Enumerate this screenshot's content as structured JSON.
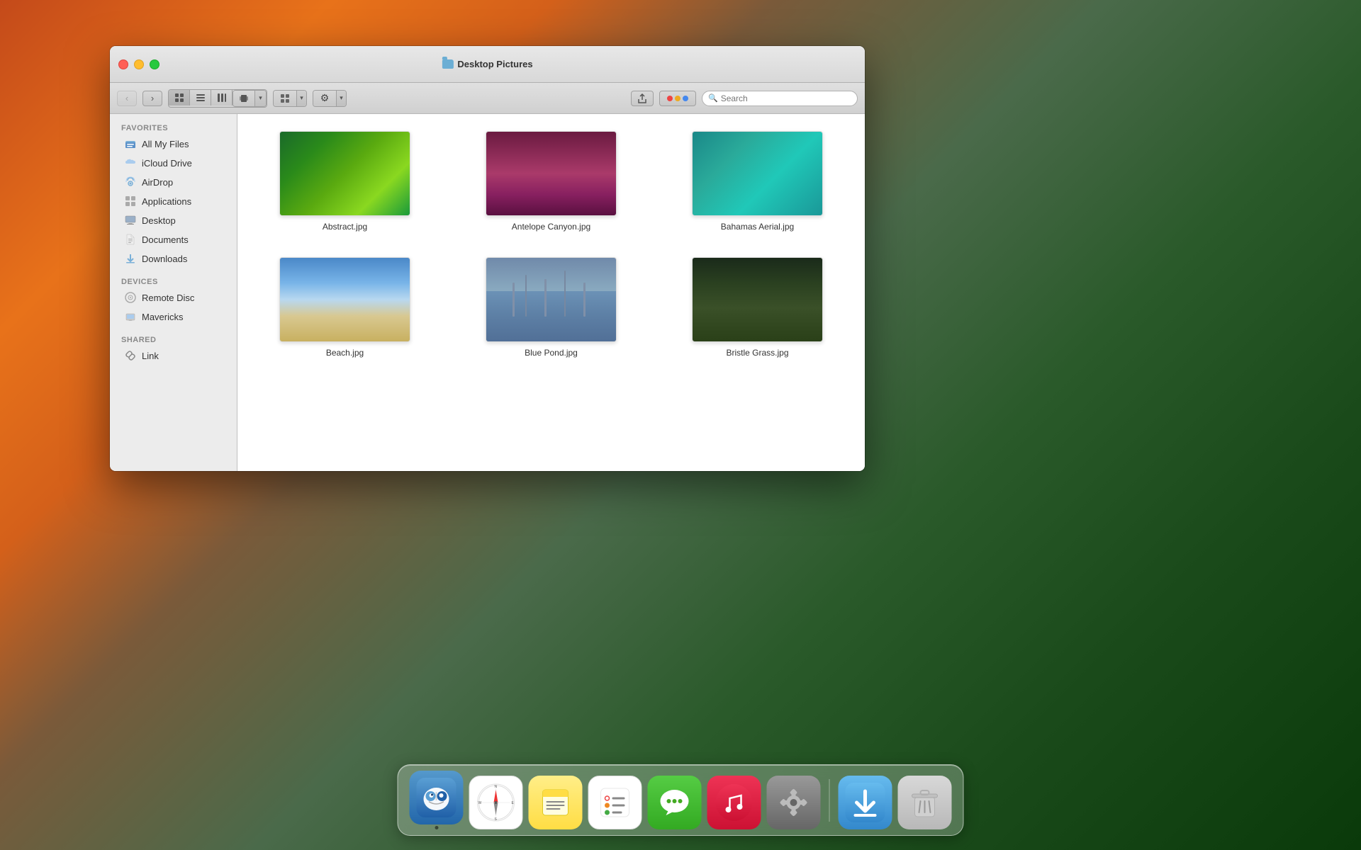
{
  "window": {
    "title": "Desktop Pictures",
    "buttons": {
      "close": "close",
      "minimize": "minimize",
      "maximize": "maximize"
    }
  },
  "toolbar": {
    "back_label": "‹",
    "forward_label": "›",
    "view_icon": "⊞",
    "list_icon": "≡",
    "column_icon": "⊟",
    "cover_icon": "⊞",
    "arrange_icon": "⊞",
    "gear_label": "⚙",
    "share_label": "↑",
    "tag_label": "●",
    "search_placeholder": "Search"
  },
  "sidebar": {
    "sections": [
      {
        "id": "favorites",
        "label": "Favorites",
        "items": [
          {
            "id": "all-my-files",
            "label": "All My Files",
            "icon": "star"
          },
          {
            "id": "icloud-drive",
            "label": "iCloud Drive",
            "icon": "cloud"
          },
          {
            "id": "airdrop",
            "label": "AirDrop",
            "icon": "airdrop"
          },
          {
            "id": "applications",
            "label": "Applications",
            "icon": "apps"
          },
          {
            "id": "desktop",
            "label": "Desktop",
            "icon": "desktop"
          },
          {
            "id": "documents",
            "label": "Documents",
            "icon": "doc"
          },
          {
            "id": "downloads",
            "label": "Downloads",
            "icon": "download"
          }
        ]
      },
      {
        "id": "devices",
        "label": "Devices",
        "items": [
          {
            "id": "remote-disc",
            "label": "Remote Disc",
            "icon": "disc"
          },
          {
            "id": "mavericks",
            "label": "Mavericks",
            "icon": "drive"
          }
        ]
      },
      {
        "id": "shared",
        "label": "Shared",
        "items": [
          {
            "id": "link",
            "label": "Link",
            "icon": "link"
          }
        ]
      }
    ]
  },
  "files": [
    {
      "id": "abstract",
      "name": "Abstract.jpg",
      "thumb": "abstract"
    },
    {
      "id": "antelope",
      "name": "Antelope Canyon.jpg",
      "thumb": "antelope"
    },
    {
      "id": "bahamas",
      "name": "Bahamas Aerial.jpg",
      "thumb": "bahamas"
    },
    {
      "id": "beach",
      "name": "Beach.jpg",
      "thumb": "beach"
    },
    {
      "id": "bluepond",
      "name": "Blue Pond.jpg",
      "thumb": "bluepond"
    },
    {
      "id": "bristle",
      "name": "Bristle Grass.jpg",
      "thumb": "bristle"
    }
  ],
  "dock": {
    "items": [
      {
        "id": "finder",
        "label": "Finder",
        "icon": "finder",
        "has_dot": true
      },
      {
        "id": "safari",
        "label": "Safari",
        "icon": "safari",
        "has_dot": false
      },
      {
        "id": "notes",
        "label": "Notes",
        "icon": "notes",
        "has_dot": false
      },
      {
        "id": "reminders",
        "label": "Reminders",
        "icon": "reminders",
        "has_dot": false
      },
      {
        "id": "messages",
        "label": "Messages",
        "icon": "messages",
        "has_dot": false
      },
      {
        "id": "music",
        "label": "iTunes",
        "icon": "music",
        "has_dot": false
      },
      {
        "id": "sysprefs",
        "label": "System Preferences",
        "icon": "sysprefs",
        "has_dot": false
      },
      {
        "id": "downloads",
        "label": "Downloads",
        "icon": "downloads",
        "has_dot": false
      },
      {
        "id": "trash",
        "label": "Trash",
        "icon": "trash",
        "has_dot": false
      }
    ]
  }
}
